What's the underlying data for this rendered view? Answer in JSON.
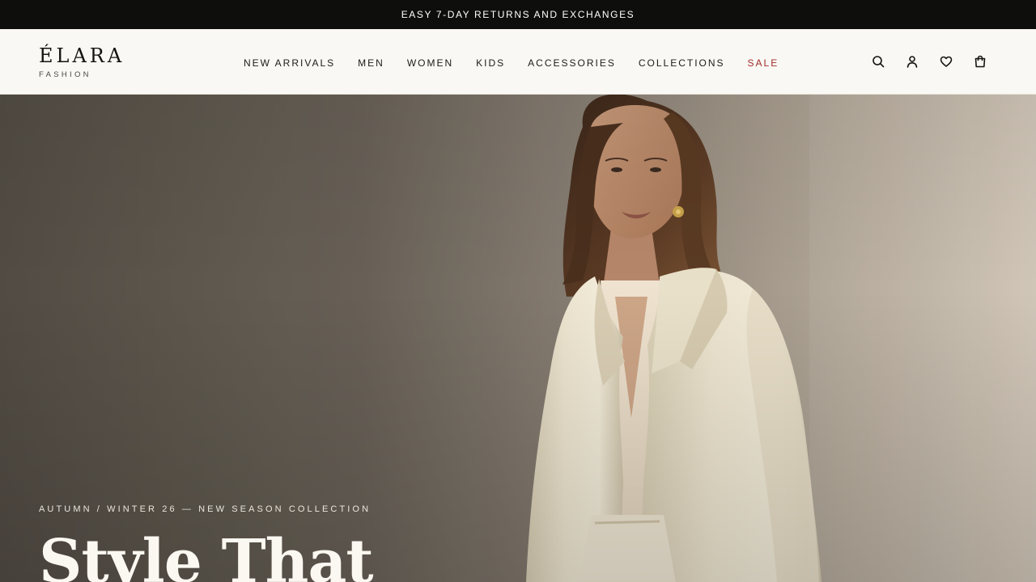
{
  "announcement": {
    "text": "EASY 7-DAY RETURNS AND EXCHANGES"
  },
  "brand": {
    "name": "ÉLARA",
    "tagline": "FASHION"
  },
  "nav": {
    "items": [
      {
        "label": "NEW ARRIVALS"
      },
      {
        "label": "MEN"
      },
      {
        "label": "WOMEN"
      },
      {
        "label": "KIDS"
      },
      {
        "label": "ACCESSORIES"
      },
      {
        "label": "COLLECTIONS"
      },
      {
        "label": "SALE"
      }
    ],
    "sale_color": "#a12b29"
  },
  "header_icons": [
    "search-icon",
    "account-icon",
    "wishlist-icon",
    "cart-icon"
  ],
  "hero": {
    "eyebrow": "AUTUMN / WINTER 26 — NEW SEASON COLLECTION",
    "title": "Style That"
  },
  "colors": {
    "announcement_bg": "#0e0e0d",
    "header_bg": "#f9f8f4",
    "text": "#141412"
  }
}
